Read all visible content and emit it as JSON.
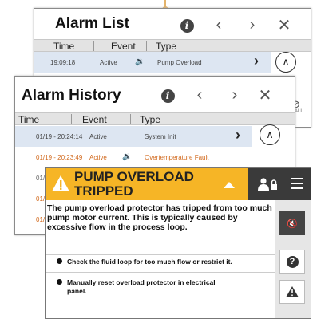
{
  "alarm_list": {
    "title": "Alarm List",
    "columns": [
      "Time",
      "Event",
      "Type"
    ],
    "rows": [
      {
        "time": "19:09:18",
        "event": "Active",
        "type": "Pump Overload"
      }
    ]
  },
  "alarm_history": {
    "title": "Alarm History",
    "columns": [
      "Time",
      "Event",
      "Type"
    ],
    "rows": [
      {
        "time": "01/19 - 20:24:14",
        "event": "Active",
        "type": "System Init"
      },
      {
        "time": "01/19 - 20:23:49",
        "event": "Active",
        "type": "Overtemperature Fault"
      },
      {
        "time": "01/"
      },
      {
        "time": "01/"
      },
      {
        "time": "01/"
      }
    ]
  },
  "side_labels": {
    "all": "ALL"
  },
  "popup": {
    "title_line1": "PUMP OVERLOAD",
    "title_line2": "TRIPPED",
    "description": "The pump overload protector has tripped from too much pump motor current. This is typically caused by excessive flow in the process loop.",
    "steps": [
      "Check the fluid loop for too much flow or restrict it.",
      "Manually reset overload protector in electrical",
      "panel."
    ]
  },
  "colors": {
    "banner": "#f6b526",
    "dark_bar": "#3a3a3a",
    "orange_text": "#d26a1e",
    "header_bg": "#e3e3e3"
  }
}
